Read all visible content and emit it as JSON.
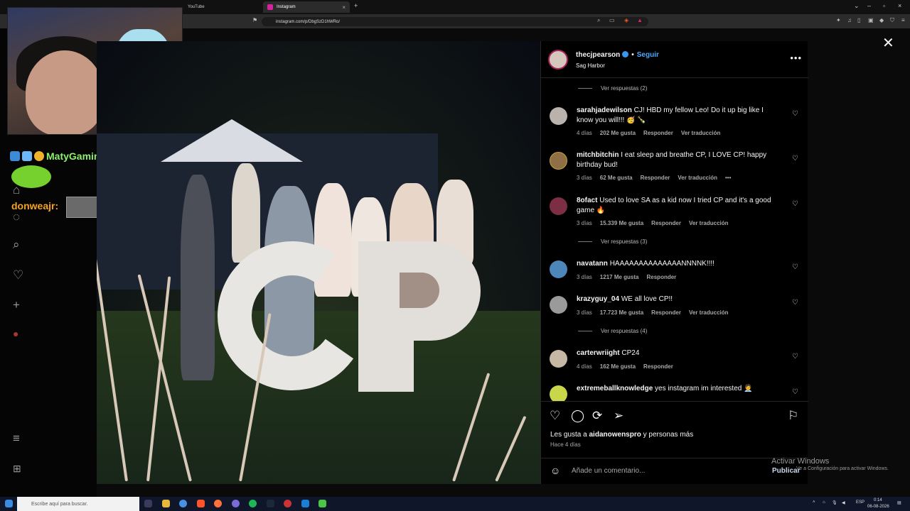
{
  "browser": {
    "tabs": [
      {
        "label": "YouTube",
        "active": false
      },
      {
        "label": "Instagram",
        "active": true
      }
    ],
    "url": "instagram.com/p/DbgSzD1hWRo/"
  },
  "stream_chat": {
    "user1": "MatyGamingHD:",
    "user2": "donweajr:"
  },
  "post": {
    "username": "thecjpearson",
    "follow_label": "Seguir",
    "location": "Sag Harbor",
    "more_label": "•••",
    "replies_1": "Ver respuestas (2)",
    "replies_2": "Ver respuestas (3)",
    "replies_3": "Ver respuestas (4)",
    "comments": [
      {
        "user": "sarahjadewilson",
        "text": "CJ! HBD my fellow Leo! Do it up big like I know you will!!! 🥳 🍾",
        "age": "4 días",
        "likes": "202 Me gusta",
        "reply": "Responder",
        "translate": "Ver traducción",
        "avatar_color": "#b9b2ad"
      },
      {
        "user": "mitchbitchin",
        "text": "I eat sleep and breathe CP, I LOVE CP! happy birthday bud!",
        "age": "3 días",
        "likes": "62 Me gusta",
        "reply": "Responder",
        "translate": "Ver traducción",
        "extra": "•••",
        "avatar_color": "#8f6f45"
      },
      {
        "user": "8ofact",
        "text": "Used to love SA as a kid now I tried CP and it's a good game 🔥",
        "age": "3 días",
        "likes": "15.339 Me gusta",
        "reply": "Responder",
        "translate": "Ver traducción",
        "avatar_color": "#7b2e44"
      },
      {
        "user": "navatann",
        "text": "HAAAAAAAAAAAAAANNNNK!!!!",
        "age": "3 días",
        "likes": "1217 Me gusta",
        "reply": "Responder",
        "translate": "",
        "avatar_color": "#4d86b8"
      },
      {
        "user": "krazyguy_04",
        "text": "WE all love CP!!",
        "age": "3 días",
        "likes": "17.723 Me gusta",
        "reply": "Responder",
        "translate": "Ver traducción",
        "avatar_color": "#9a9a9a"
      },
      {
        "user": "carterwriight",
        "text": "CP24",
        "age": "4 días",
        "likes": "162 Me gusta",
        "reply": "Responder",
        "translate": "",
        "avatar_color": "#c7b7a5"
      },
      {
        "user": "extremeballknowledge",
        "text": "yes instagram im interested 🧑‍💼",
        "age": "",
        "likes": "",
        "reply": "",
        "translate": "",
        "avatar_color": "#c8d64a"
      }
    ],
    "liked_by_prefix": "Les gusta a",
    "liked_by_user": "aidanowenspro",
    "liked_by_suffix": "y personas más",
    "time_ago": "Hace 4 días",
    "comment_placeholder": "Añade un comentario...",
    "publish_label": "Publicar"
  },
  "windows": {
    "activate_title": "Activar Windows",
    "activate_sub": "Ve a Configuración para activar Windows.",
    "search_placeholder": "Escribe aquí para buscar.",
    "lang": "ESP",
    "time": "0:14",
    "date": "06-08-2026"
  },
  "colors": {
    "verified": "#3897f0",
    "follow": "#4ea8ff",
    "chat_user1": "#8ff06f",
    "chat_user2": "#f5a31f"
  }
}
